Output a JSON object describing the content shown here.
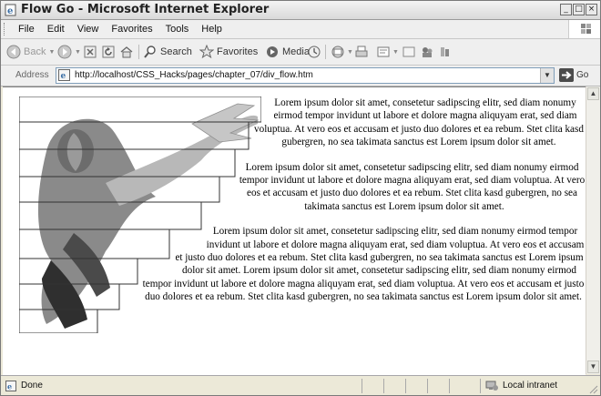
{
  "window": {
    "title": "Flow Go - Microsoft Internet Explorer"
  },
  "menu": [
    "File",
    "Edit",
    "View",
    "Favorites",
    "Tools",
    "Help"
  ],
  "toolbar": {
    "back": "Back",
    "search": "Search",
    "favorites": "Favorites",
    "media": "Media"
  },
  "address": {
    "label": "Address",
    "url": "http://localhost/CSS_Hacks/pages/chapter_07/div_flow.htm",
    "go": "Go"
  },
  "content": {
    "paragraphs": [
      "Lorem ipsum dolor sit amet, consetetur sadipscing elitr, sed diam nonumy eirmod tempor invidunt ut labore et dolore magna aliquyam erat, sed diam voluptua. At vero eos et accusam et justo duo dolores et ea rebum. Stet clita kasd gubergren, no sea takimata sanctus est Lorem ipsum dolor sit amet.",
      "Lorem ipsum dolor sit amet, consetetur sadipscing elitr, sed diam nonumy eirmod tempor invidunt ut labore et dolore magna aliquyam erat, sed diam voluptua. At vero eos et accusam et justo duo dolores et ea rebum. Stet clita kasd gubergren, no sea takimata sanctus est Lorem ipsum dolor sit amet.",
      "Lorem ipsum dolor sit amet, consetetur sadipscing elitr, sed diam nonumy eirmod tempor invidunt ut labore et dolore magna aliquyam erat, sed diam voluptua. At vero eos et accusam et justo duo dolores et ea rebum. Stet clita kasd gubergren, no sea takimata sanctus est Lorem ipsum dolor sit amet. Lorem ipsum dolor sit amet, consetetur sadipscing elitr, sed diam nonumy eirmod tempor invidunt ut labore et dolore magna aliquyam erat, sed diam voluptua. At vero eos et accusam et justo duo dolores et ea rebum. Stet clita kasd gubergren, no sea takimata sanctus est Lorem ipsum dolor sit amet."
    ]
  },
  "status": {
    "text": "Done",
    "zone": "Local intranet"
  },
  "colors": {
    "ie_blue": "#3a6ea5",
    "go_green": "#3c9a3c",
    "frame": "#ece9d8"
  },
  "icons": [
    "ie-page-icon",
    "back-arrow-icon",
    "forward-arrow-icon",
    "stop-icon",
    "refresh-icon",
    "home-icon",
    "search-icon",
    "favorites-star-icon",
    "media-icon",
    "history-icon",
    "mail-icon",
    "print-icon",
    "edit-icon",
    "discuss-icon",
    "messenger-icon",
    "go-arrow-icon",
    "local-intranet-icon"
  ]
}
